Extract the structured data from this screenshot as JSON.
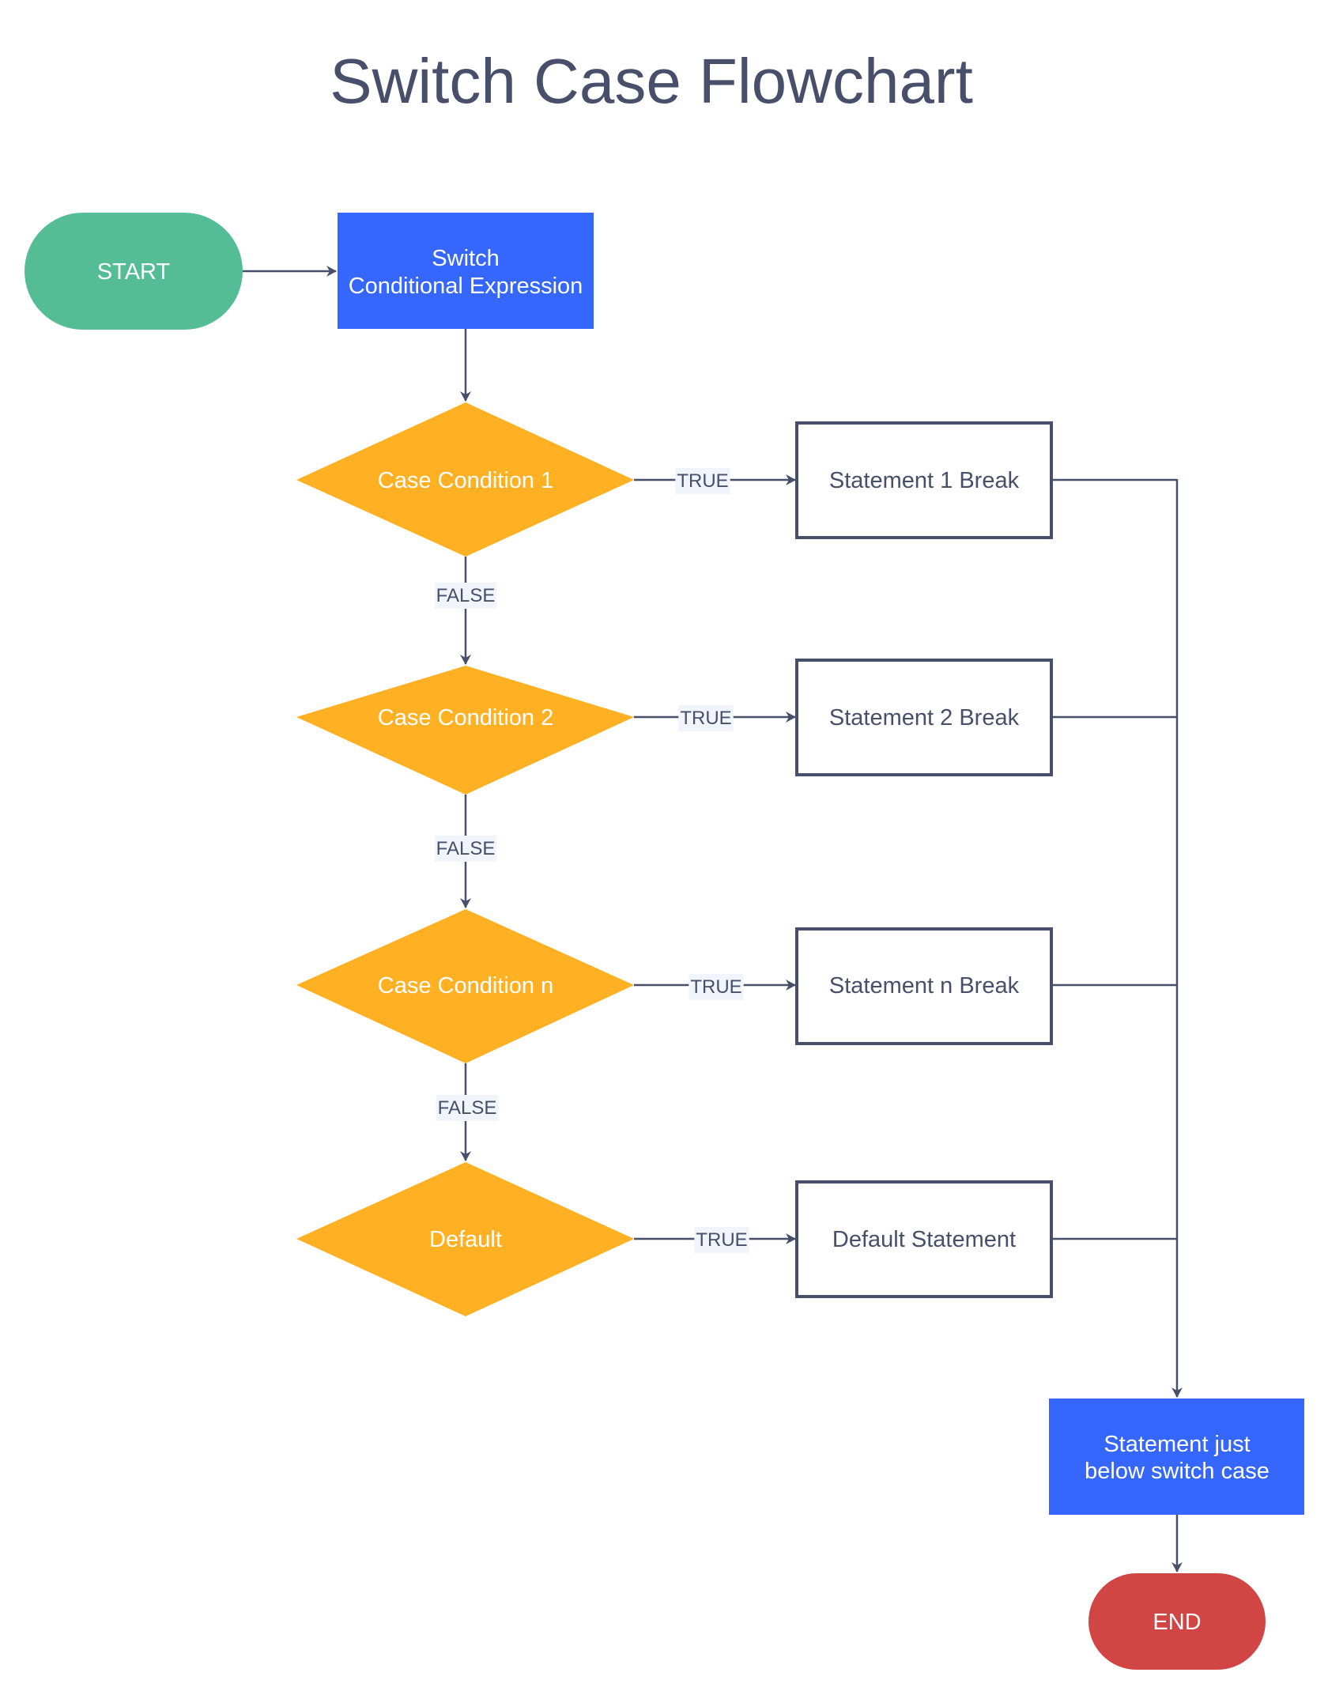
{
  "title": "Switch Case Flowchart",
  "colors": {
    "text": "#474f6a",
    "start": "#54bd95",
    "process": "#3567ff",
    "decision": "#ffb023",
    "end": "#d24545",
    "statement_border": "#474f6a",
    "label_bg": "#f1f4fa"
  },
  "nodes": {
    "start": {
      "label": "START",
      "shape": "terminator"
    },
    "switch": {
      "label_lines": [
        "Switch",
        "Conditional Expression"
      ],
      "shape": "process"
    },
    "case1": {
      "label": "Case Condition 1",
      "shape": "decision"
    },
    "case2": {
      "label": "Case Condition 2",
      "shape": "decision"
    },
    "casen": {
      "label": "Case Condition n",
      "shape": "decision"
    },
    "default": {
      "label": "Default",
      "shape": "decision"
    },
    "stmt1": {
      "label": "Statement 1 Break",
      "shape": "statement"
    },
    "stmt2": {
      "label": "Statement 2 Break",
      "shape": "statement"
    },
    "stmtn": {
      "label": "Statement n Break",
      "shape": "statement"
    },
    "stmtdefault": {
      "label": "Default Statement",
      "shape": "statement"
    },
    "after": {
      "label_lines": [
        "Statement just",
        "below switch case"
      ],
      "shape": "process"
    },
    "end": {
      "label": "END",
      "shape": "terminator"
    }
  },
  "edges": [
    {
      "from": "start",
      "to": "switch",
      "label": ""
    },
    {
      "from": "switch",
      "to": "case1",
      "label": ""
    },
    {
      "from": "case1",
      "to": "stmt1",
      "label": "TRUE"
    },
    {
      "from": "case1",
      "to": "case2",
      "label": "FALSE"
    },
    {
      "from": "case2",
      "to": "stmt2",
      "label": "TRUE"
    },
    {
      "from": "case2",
      "to": "casen",
      "label": "FALSE"
    },
    {
      "from": "casen",
      "to": "stmtn",
      "label": "TRUE"
    },
    {
      "from": "casen",
      "to": "default",
      "label": "FALSE"
    },
    {
      "from": "default",
      "to": "stmtdefault",
      "label": "TRUE"
    },
    {
      "from": "stmt1",
      "to": "after",
      "label": ""
    },
    {
      "from": "stmt2",
      "to": "after",
      "label": ""
    },
    {
      "from": "stmtn",
      "to": "after",
      "label": ""
    },
    {
      "from": "stmtdefault",
      "to": "after",
      "label": ""
    },
    {
      "from": "after",
      "to": "end",
      "label": ""
    }
  ],
  "edge_labels": {
    "true": "TRUE",
    "false": "FALSE"
  }
}
